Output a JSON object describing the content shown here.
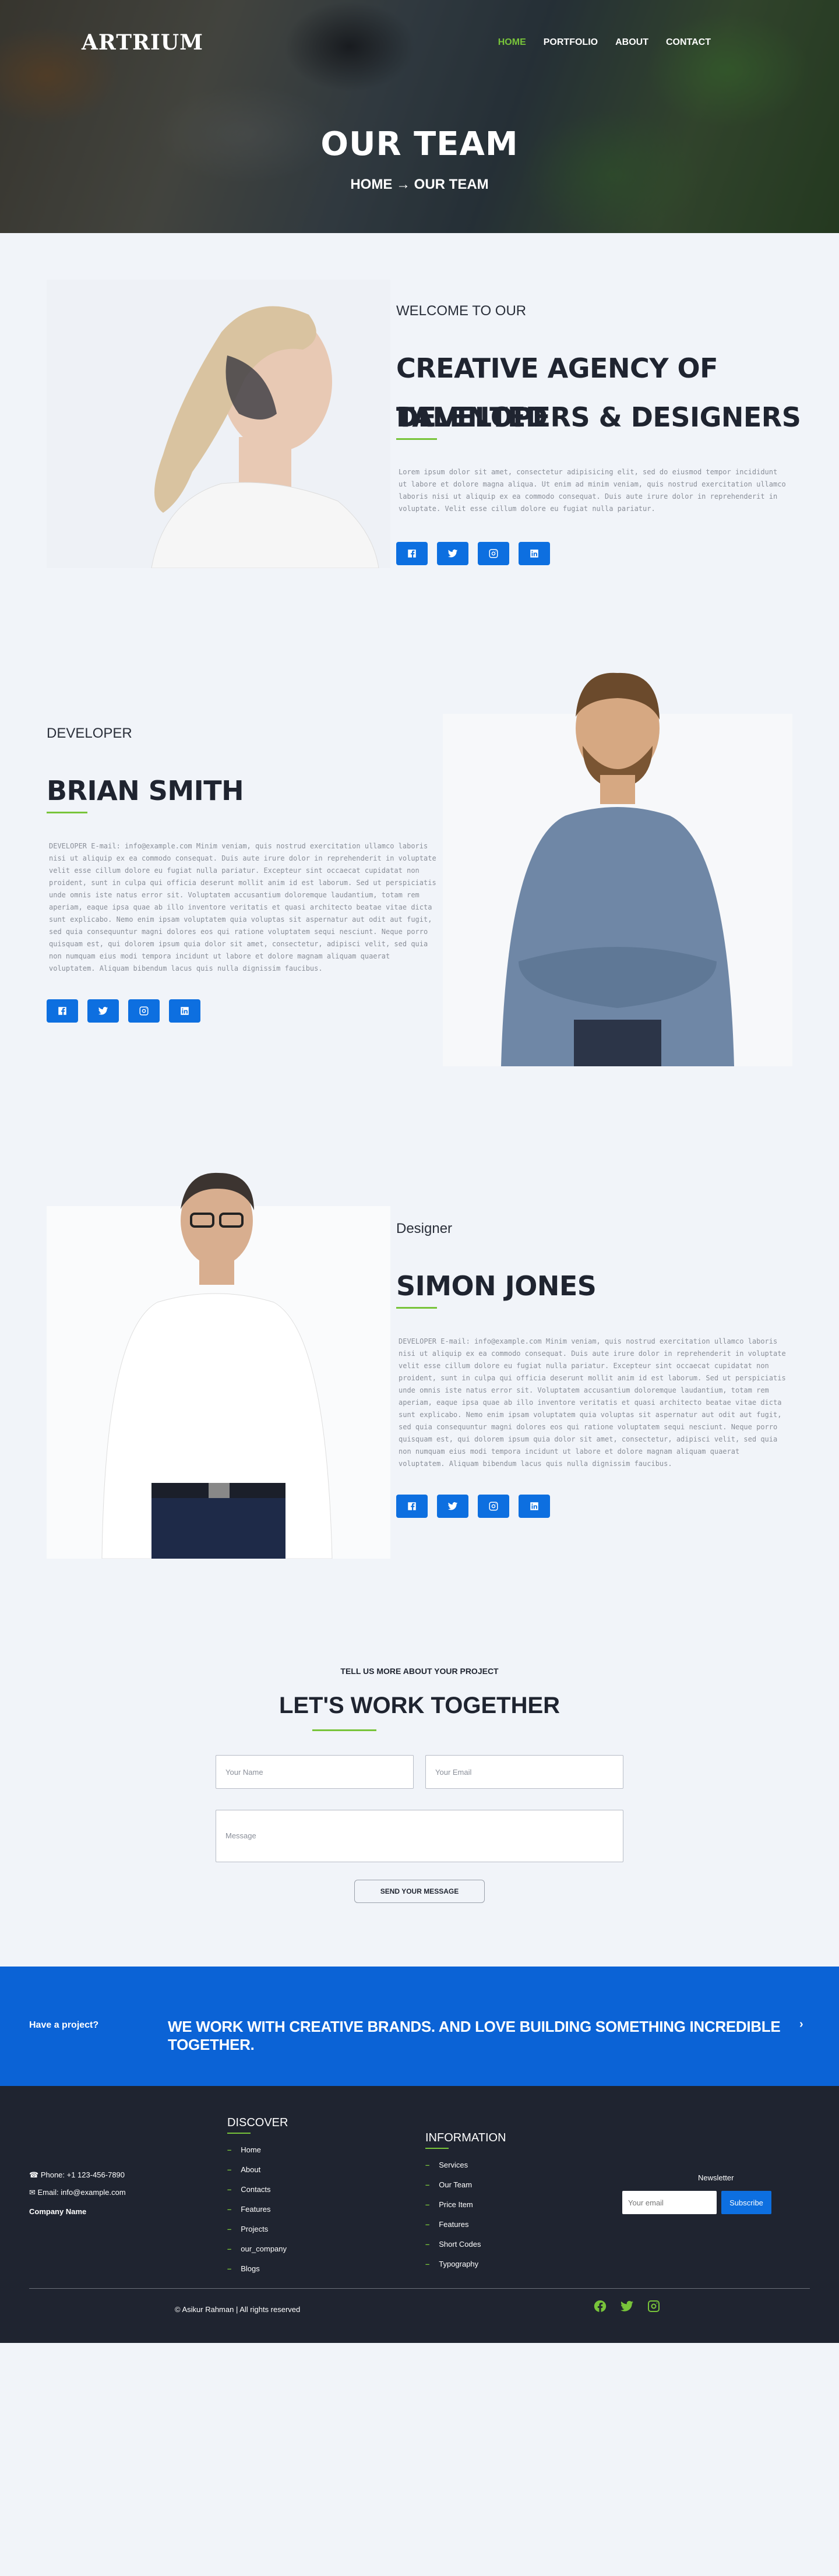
{
  "brand": {
    "logo": "ARTRIUM",
    "accent": "#78c43a",
    "primary": "#0d6fe0"
  },
  "nav": {
    "items": [
      {
        "label": "HOME",
        "active": true
      },
      {
        "label": "PORTFOLIO",
        "active": false
      },
      {
        "label": "ABOUT",
        "active": false
      },
      {
        "label": "CONTACT",
        "active": false
      }
    ]
  },
  "hero": {
    "title": "OUR TEAM",
    "breadcrumb": "HOME → OUR TEAM"
  },
  "intro": {
    "eyebrow": "WELCOME TO OUR",
    "title_line1": "CREATIVE AGENCY OF TALENTED",
    "title_line2": "DEVELOPERS & DESIGNERS",
    "text": "Lorem ipsum dolor sit amet, consectetur adipisicing elit, sed do eiusmod tempor incididunt ut labore et dolore magna aliqua. Ut enim ad minim veniam, quis nostrud exercitation ullamco laboris nisi ut aliquip ex ea commodo consequat. Duis aute irure dolor in reprehenderit in voluptate. Velit esse cillum dolore eu fugiat nulla pariatur.",
    "socials": [
      "facebook-icon",
      "twitter-icon",
      "instagram-icon",
      "linkedin-icon"
    ]
  },
  "members": [
    {
      "role": "DEVELOPER",
      "name": "BRIAN SMITH",
      "text": "DEVELOPER E-mail: info@example.com Minim veniam, quis nostrud exercitation ullamco laboris nisi ut aliquip ex ea commodo consequat. Duis aute irure dolor in reprehenderit in voluptate velit esse cillum dolore eu fugiat nulla pariatur. Excepteur sint occaecat cupidatat non proident, sunt in culpa qui officia deserunt mollit anim id est laborum. Sed ut perspiciatis unde omnis iste natus error sit. Voluptatem accusantium doloremque laudantium, totam rem aperiam, eaque ipsa quae ab illo inventore veritatis et quasi architecto beatae vitae dicta sunt explicabo. Nemo enim ipsam voluptatem quia voluptas sit aspernatur aut odit aut fugit, sed quia consequuntur magni dolores eos qui ratione voluptatem sequi nesciunt. Neque porro quisquam est, qui dolorem ipsum quia dolor sit amet, consectetur, adipisci velit, sed quia non numquam eius modi tempora incidunt ut labore et dolore magnam aliquam quaerat voluptatem. Aliquam bibendum lacus quis nulla dignissim faucibus."
    },
    {
      "role": "Designer",
      "name": "SIMON JONES",
      "text": "DEVELOPER E-mail: info@example.com Minim veniam, quis nostrud exercitation ullamco laboris nisi ut aliquip ex ea commodo consequat. Duis aute irure dolor in reprehenderit in voluptate velit esse cillum dolore eu fugiat nulla pariatur. Excepteur sint occaecat cupidatat non proident, sunt in culpa qui officia deserunt mollit anim id est laborum. Sed ut perspiciatis unde omnis iste natus error sit. Voluptatem accusantium doloremque laudantium, totam rem aperiam, eaque ipsa quae ab illo inventore veritatis et quasi architecto beatae vitae dicta sunt explicabo. Nemo enim ipsam voluptatem quia voluptas sit aspernatur aut odit aut fugit, sed quia consequuntur magni dolores eos qui ratione voluptatem sequi nesciunt. Neque porro quisquam est, qui dolorem ipsum quia dolor sit amet, consectetur, adipisci velit, sed quia non numquam eius modi tempora incidunt ut labore et dolore magnam aliquam quaerat voluptatem. Aliquam bibendum lacus quis nulla dignissim faucibus."
    }
  ],
  "contact": {
    "eyebrow": "TELL US MORE ABOUT YOUR PROJECT",
    "title": "LET'S WORK TOGETHER",
    "name_placeholder": "Your Name",
    "email_placeholder": "Your Email",
    "message_placeholder": "Message",
    "send_label": "SEND YOUR MESSAGE"
  },
  "banner": {
    "have_project": "Have a project?",
    "message": "WE WORK WITH CREATIVE BRANDS. AND LOVE BUILDING SOMETHING INCREDIBLE TOGETHER.",
    "arrow": "›"
  },
  "footer": {
    "phone": "Phone: +1 123-456-7890",
    "email": "Email: info@example.com",
    "company": "Company Name",
    "discover": {
      "title": "DISCOVER",
      "items": [
        "Home",
        "About",
        "Contacts",
        "Features",
        "Projects",
        "our_company",
        "Blogs"
      ]
    },
    "information": {
      "title": "INFORMATION",
      "items": [
        "Services",
        "Our Team",
        "Price Item",
        "Features",
        "Short Codes",
        "Typography"
      ]
    },
    "newsletter": {
      "label": "Newsletter",
      "placeholder": "Your email",
      "button": "Subscribe"
    },
    "copyright": "© Asikur Rahman | All rights reserved",
    "socials": [
      "facebook-icon",
      "twitter-icon",
      "instagram-icon"
    ]
  }
}
